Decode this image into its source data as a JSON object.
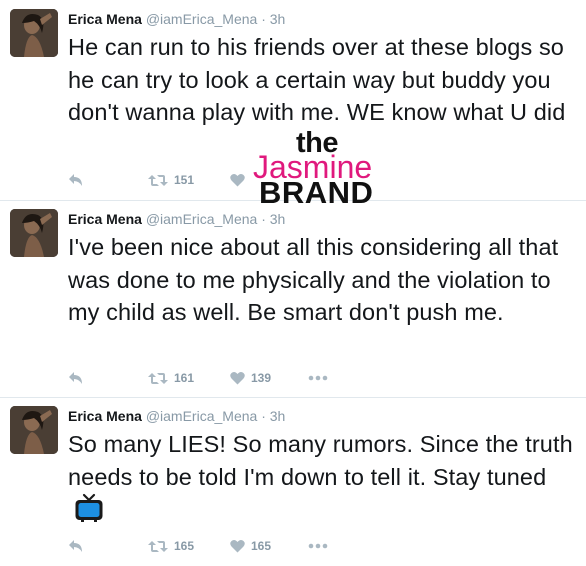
{
  "tweets": [
    {
      "name": "Erica Mena",
      "handle": "@iamErica_Mena",
      "dot": "·",
      "time": "3h",
      "text": "He can run to his friends over at these blogs so he can try to look a certain way but buddy you don't wanna play with me. WE know what U did",
      "retweets": "151",
      "likes": ""
    },
    {
      "name": "Erica Mena",
      "handle": "@iamErica_Mena",
      "dot": "·",
      "time": "3h",
      "text": "I've been nice about all this considering all that was done to me physically and the violation to my child as well. Be smart don't push me.",
      "retweets": "161",
      "likes": "139"
    },
    {
      "name": "Erica Mena",
      "handle": "@iamErica_Mena",
      "dot": "·",
      "time": "3h",
      "text": "So many LIES! So many rumors. Since the truth needs to be told I'm down to tell it. Stay tuned",
      "retweets": "165",
      "likes": "165"
    }
  ],
  "watermark": {
    "line1": "the",
    "line2": "Jasmine",
    "line3": "BRAND"
  },
  "icons": {
    "reply": "reply-icon",
    "retweet": "retweet-icon",
    "like": "heart-icon",
    "more": "more-icon",
    "tv": "television-emoji-icon"
  },
  "colors": {
    "text": "#14171a",
    "meta": "#8899a6",
    "watermark_pink": "#e0197d",
    "tv_blue": "#1d8fe1"
  }
}
